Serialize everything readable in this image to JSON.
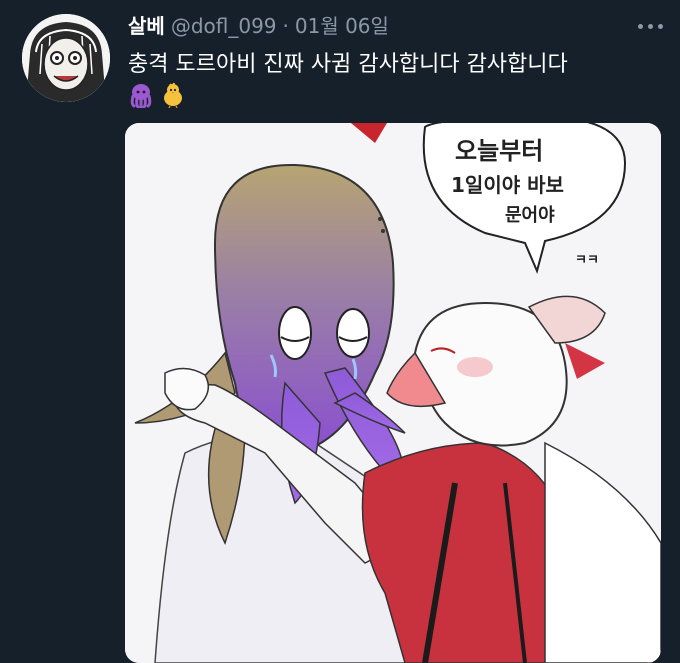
{
  "tweet": {
    "display_name": "살베",
    "handle": "@dofl_099",
    "separator": "·",
    "date": "01월 06일",
    "text": "충격 도르아비 진짜 사귐 감사합니다 감사합니다",
    "emojis": [
      "octopus-emoji",
      "chick-emoji"
    ]
  },
  "image": {
    "bubble_lines": [
      "오늘부터",
      "1일이야 바보",
      "문어야"
    ],
    "laugh": "ㅋㅋ"
  },
  "colors": {
    "background": "#15202b",
    "secondary_text": "#8b98a5",
    "octopus_purple": "#8a4fd0",
    "jacket_red": "#c8323f"
  }
}
